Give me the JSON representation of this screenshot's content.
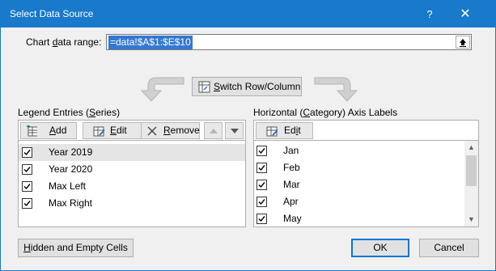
{
  "window": {
    "title": "Select Data Source",
    "help": "?",
    "close": "✕"
  },
  "range": {
    "label_pre": "Chart ",
    "label_u": "d",
    "label_post": "ata range:",
    "value": "=data!$A$1:$E$10"
  },
  "switch": {
    "pre": "",
    "u": "S",
    "post": "witch Row/Column"
  },
  "legend": {
    "label_pre": "Legend Entries (",
    "label_u": "S",
    "label_post": "eries)",
    "add": {
      "u": "A",
      "post": "dd"
    },
    "edit": {
      "u": "E",
      "post": "dit"
    },
    "remove": {
      "u": "R",
      "post": "emove"
    },
    "items": [
      {
        "label": "Year 2019",
        "checked": true,
        "selected": true
      },
      {
        "label": "Year 2020",
        "checked": true
      },
      {
        "label": "Max Left",
        "checked": true
      },
      {
        "label": "Max Right",
        "checked": true
      }
    ]
  },
  "axis": {
    "label_pre": "Horizontal (",
    "label_u": "C",
    "label_post": "ategory) Axis Labels",
    "edit": {
      "pre": "Ed",
      "u": "i",
      "post": "t"
    },
    "items": [
      {
        "label": "Jan",
        "checked": true
      },
      {
        "label": "Feb",
        "checked": true
      },
      {
        "label": "Mar",
        "checked": true
      },
      {
        "label": "Apr",
        "checked": true
      },
      {
        "label": "May",
        "checked": true
      }
    ]
  },
  "footer": {
    "hidden": {
      "u": "H",
      "post": "idden and Empty Cells"
    },
    "ok": "OK",
    "cancel": "Cancel"
  },
  "colors": {
    "titlebar": "#1979ca",
    "selection": "#3478d1"
  }
}
